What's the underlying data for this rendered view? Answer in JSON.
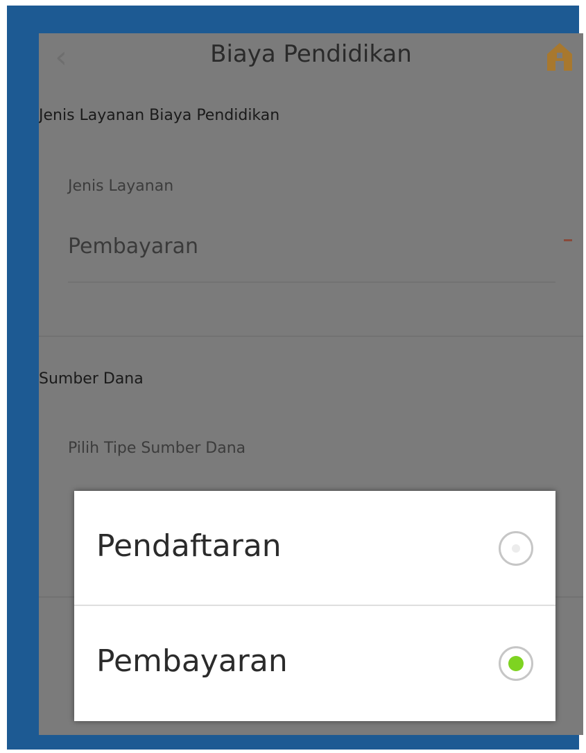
{
  "header": {
    "title": "Biaya Pendidikan",
    "back_icon": "chevron-left-icon",
    "home_icon": "home-icon",
    "home_color": "#e08a12"
  },
  "service_section": {
    "title": "Jenis Layanan Biaya Pendidikan",
    "field_label": "Jenis Layanan",
    "field_value": "Pembayaran"
  },
  "fund_section": {
    "title": "Sumber Dana",
    "field_label": "Pilih Tipe Sumber Dana"
  },
  "dialog": {
    "options": [
      {
        "label": "Pendaftaran",
        "selected": false
      },
      {
        "label": "Pembayaran",
        "selected": true
      }
    ],
    "selected_color": "#7ed321"
  }
}
